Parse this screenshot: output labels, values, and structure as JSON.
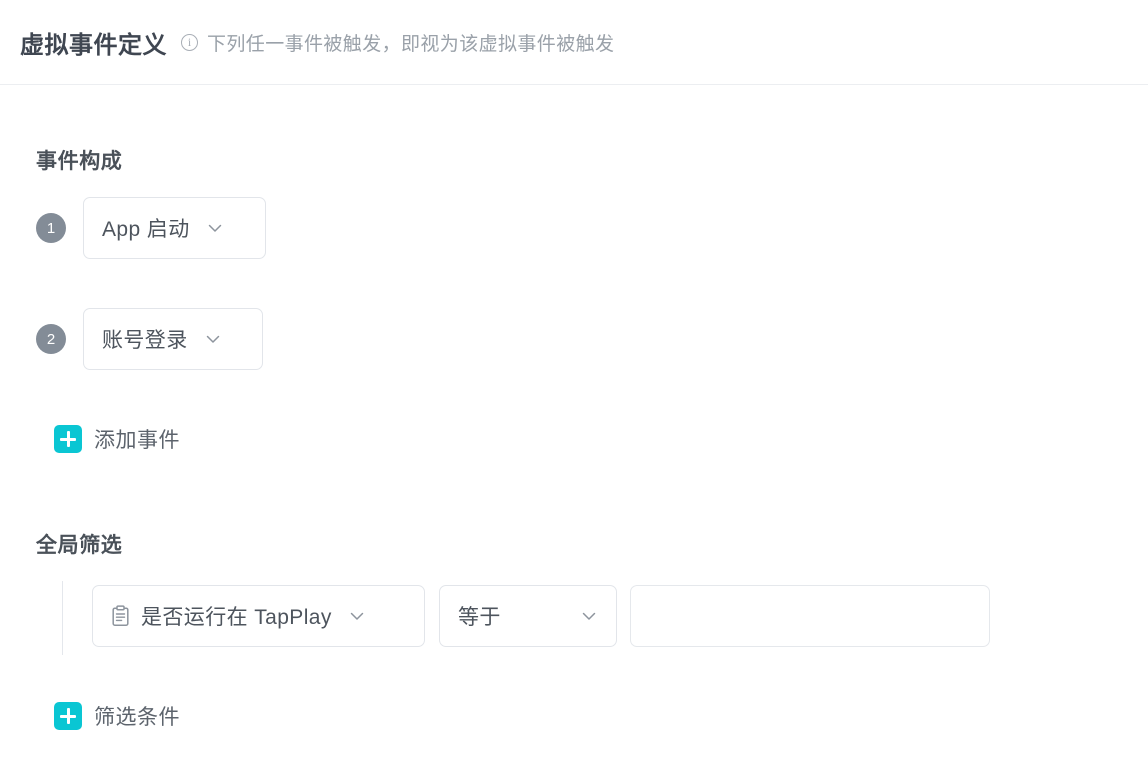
{
  "header": {
    "title": "虚拟事件定义",
    "info_icon": "info-circle-icon",
    "hint": "下列任一事件被触发，即视为该虚拟事件被触发"
  },
  "theme": {
    "accent": "#0ac6d3",
    "badge_bg": "#838c97",
    "text_primary": "#4a5159",
    "text_secondary": "#9aa1a9",
    "border": "#e2e5ea"
  },
  "event_section": {
    "title": "事件构成",
    "rows": [
      {
        "step": "1",
        "event": "App 启动",
        "chevron": "chevron-down-icon"
      },
      {
        "step": "2",
        "event": "账号登录",
        "chevron": "chevron-down-icon"
      }
    ],
    "add_button": {
      "icon": "plus-square-icon",
      "label": "添加事件"
    }
  },
  "filter_section": {
    "title": "全局筛选",
    "rows": [
      {
        "property_icon": "clipboard-icon",
        "property": "是否运行在 TapPlay",
        "property_chevron": "chevron-down-icon",
        "operator": "等于",
        "operator_chevron": "chevron-down-icon",
        "value": "",
        "value_placeholder": ""
      }
    ],
    "add_button": {
      "icon": "plus-square-icon",
      "label": "筛选条件"
    }
  }
}
